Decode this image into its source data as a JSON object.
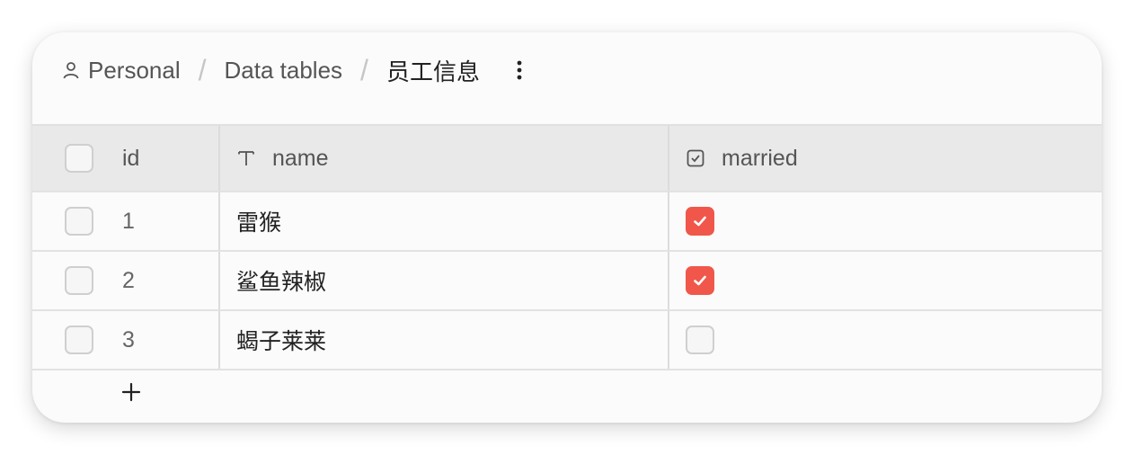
{
  "breadcrumb": {
    "items": [
      {
        "label": "Personal",
        "icon": "user-icon"
      },
      {
        "label": "Data tables"
      },
      {
        "label": "员工信息"
      }
    ],
    "separator": "/"
  },
  "table": {
    "columns": [
      {
        "label": "id"
      },
      {
        "label": "name",
        "icon": "text-type-icon"
      },
      {
        "label": "married",
        "icon": "checkbox-type-icon"
      }
    ],
    "rows": [
      {
        "id": "1",
        "name": "雷猴",
        "married": true
      },
      {
        "id": "2",
        "name": "鲨鱼辣椒",
        "married": true
      },
      {
        "id": "3",
        "name": "蝎子莱莱",
        "married": false
      }
    ]
  },
  "colors": {
    "accent": "#f0574a",
    "header_bg": "#e9e9e9",
    "card_bg": "#fbfbfb"
  }
}
